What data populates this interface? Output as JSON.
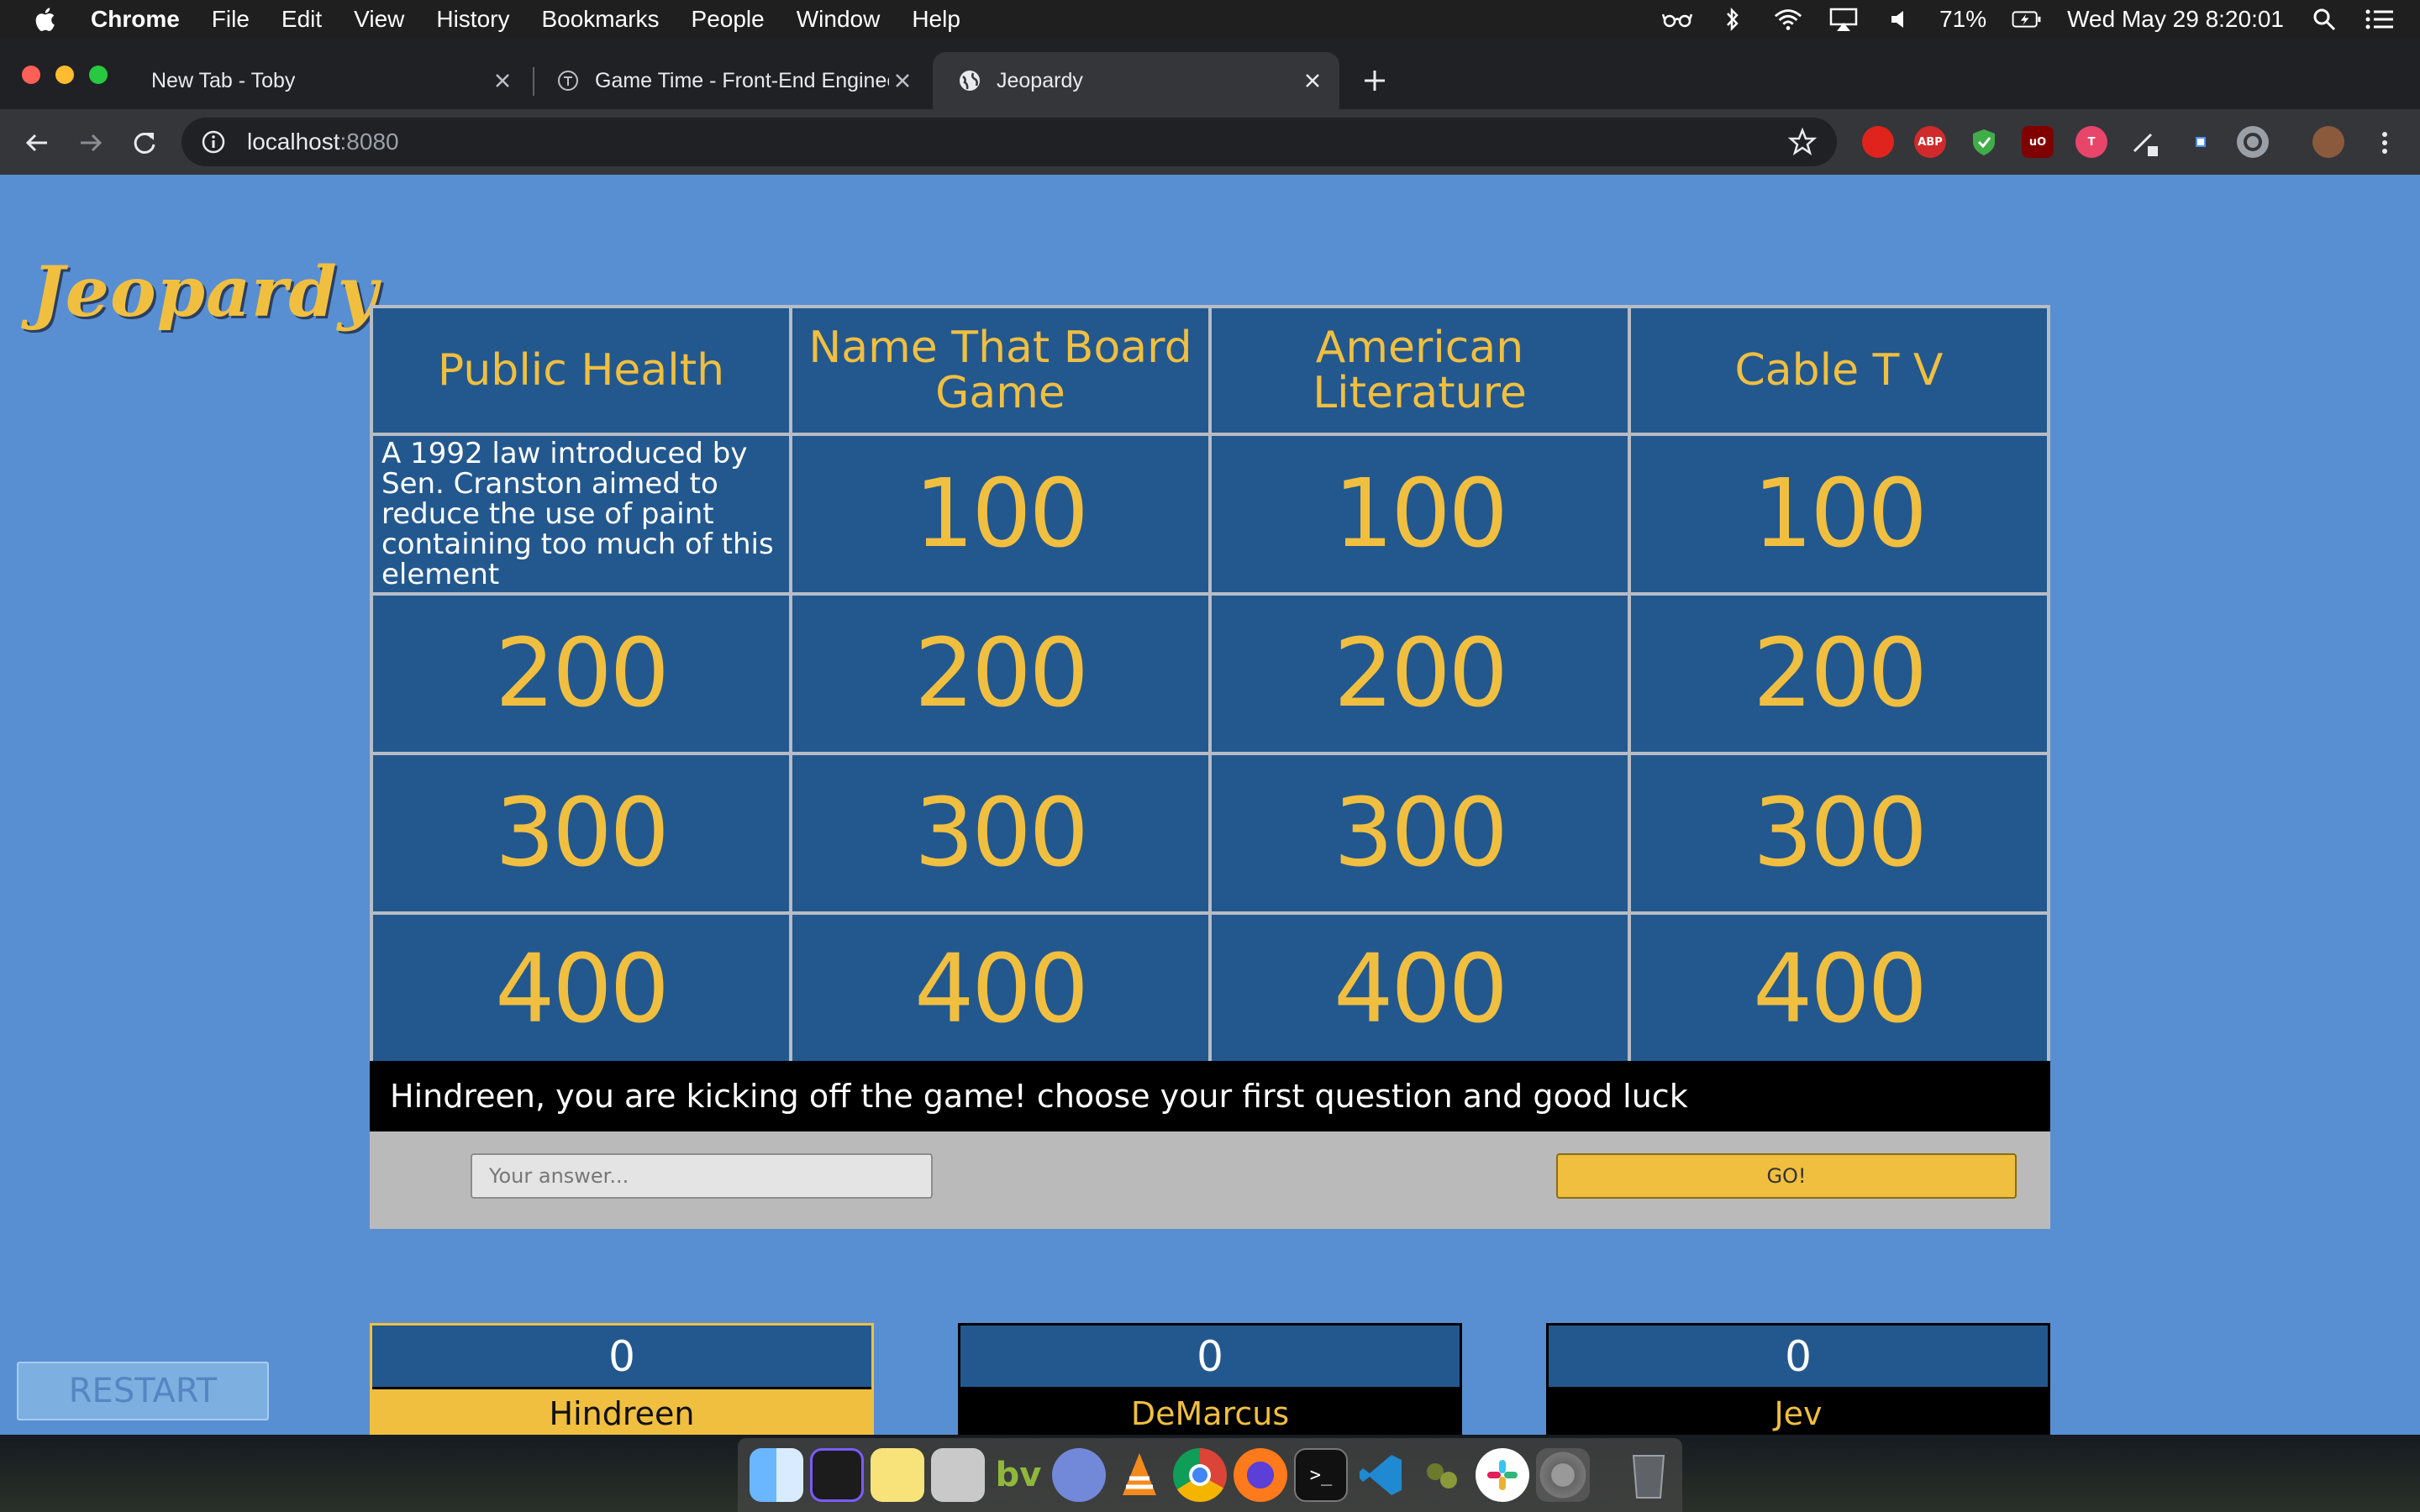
{
  "menubar": {
    "app_name": "Chrome",
    "items": [
      "File",
      "Edit",
      "View",
      "History",
      "Bookmarks",
      "People",
      "Window",
      "Help"
    ],
    "battery": "71%",
    "clock": "Wed May 29  8:20:01"
  },
  "browser": {
    "tabs": [
      {
        "title": "New Tab - Toby"
      },
      {
        "title": "Game Time - Front-End Engineering"
      },
      {
        "title": "Jeopardy"
      }
    ],
    "url_host": "localhost",
    "url_port": ":8080"
  },
  "game": {
    "logo": "Jeopardy",
    "categories": [
      "Public Health",
      "Name That Board Game",
      "American Literature",
      "Cable T V"
    ],
    "values": [
      "100",
      "200",
      "300",
      "400"
    ],
    "revealed_clue": "A 1992 law introduced by Sen. Cranston aimed to reduce the use of paint containing too much of this element",
    "message": "Hindreen, you are kicking off the game! choose your first question and good luck",
    "answer_placeholder": "Your answer...",
    "go_label": "GO!",
    "restart_label": "RESTART",
    "players": [
      {
        "name": "Hindreen",
        "score": "0",
        "active": true
      },
      {
        "name": "DeMarcus",
        "score": "0",
        "active": false
      },
      {
        "name": "Jev",
        "score": "0",
        "active": false
      }
    ]
  },
  "colors": {
    "page_bg": "#588fd3",
    "cell_bg": "#23588f",
    "gold": "#f1bf3f",
    "grid_line": "#b7bcc5"
  },
  "dock": {
    "apps": [
      "finder-icon",
      "screen-capture-icon",
      "stickies-icon",
      "preview-icon",
      "bbedit-icon",
      "discord-icon",
      "vlc-icon",
      "chrome-icon",
      "firefox-icon",
      "terminal-icon",
      "vscode-icon",
      "app-icon",
      "slack-icon",
      "system-preferences-icon",
      "trash-icon"
    ]
  }
}
